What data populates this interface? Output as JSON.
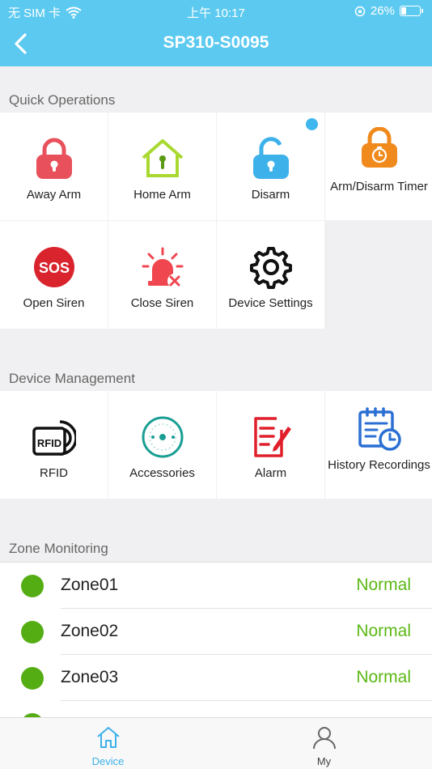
{
  "status_bar": {
    "carrier": "无 SIM 卡",
    "time": "上午 10:17",
    "battery": "26%",
    "battery_level": 0.26
  },
  "header": {
    "title": "SP310-S0095"
  },
  "quick_operations": {
    "title": "Quick Operations",
    "items": [
      {
        "label": "Away Arm",
        "icon": "locked-padlock-icon",
        "color": "#e8505b"
      },
      {
        "label": "Home Arm",
        "icon": "home-lock-icon",
        "color": "#a9d931"
      },
      {
        "label": "Disarm",
        "icon": "unlocked-padlock-icon",
        "color": "#3db1ea"
      },
      {
        "label": "Arm/Disarm Timer",
        "icon": "timer-padlock-icon",
        "color": "#f08a1c"
      },
      {
        "label": "Open Siren",
        "icon": "sos-icon",
        "color": "#d9232d",
        "icon_text": "SOS"
      },
      {
        "label": "Close Siren",
        "icon": "siren-off-icon",
        "color": "#ef4650"
      },
      {
        "label": "Device Settings",
        "icon": "gear-icon",
        "color": "#111111"
      }
    ]
  },
  "device_management": {
    "title": "Device Management",
    "items": [
      {
        "label": "RFID",
        "icon": "rfid-icon",
        "icon_text": "RFID"
      },
      {
        "label": "Accessories",
        "icon": "accessories-icon"
      },
      {
        "label": "Alarm",
        "icon": "alarm-log-icon"
      },
      {
        "label": "History Recordings",
        "icon": "history-calendar-icon"
      }
    ]
  },
  "zone_monitoring": {
    "title": "Zone Monitoring",
    "zones": [
      {
        "name": "Zone01",
        "status": "Normal"
      },
      {
        "name": "Zone02",
        "status": "Normal"
      },
      {
        "name": "Zone03",
        "status": "Normal"
      }
    ]
  },
  "tab_bar": {
    "tabs": [
      {
        "label": "Device",
        "icon": "home-icon",
        "active": true
      },
      {
        "label": "My",
        "icon": "user-icon",
        "active": false
      }
    ]
  },
  "colors": {
    "header_bg": "#5ccaf0",
    "active_tab": "#3db1ea",
    "normal_status": "#5cb815",
    "indicator": "#55ad14"
  }
}
